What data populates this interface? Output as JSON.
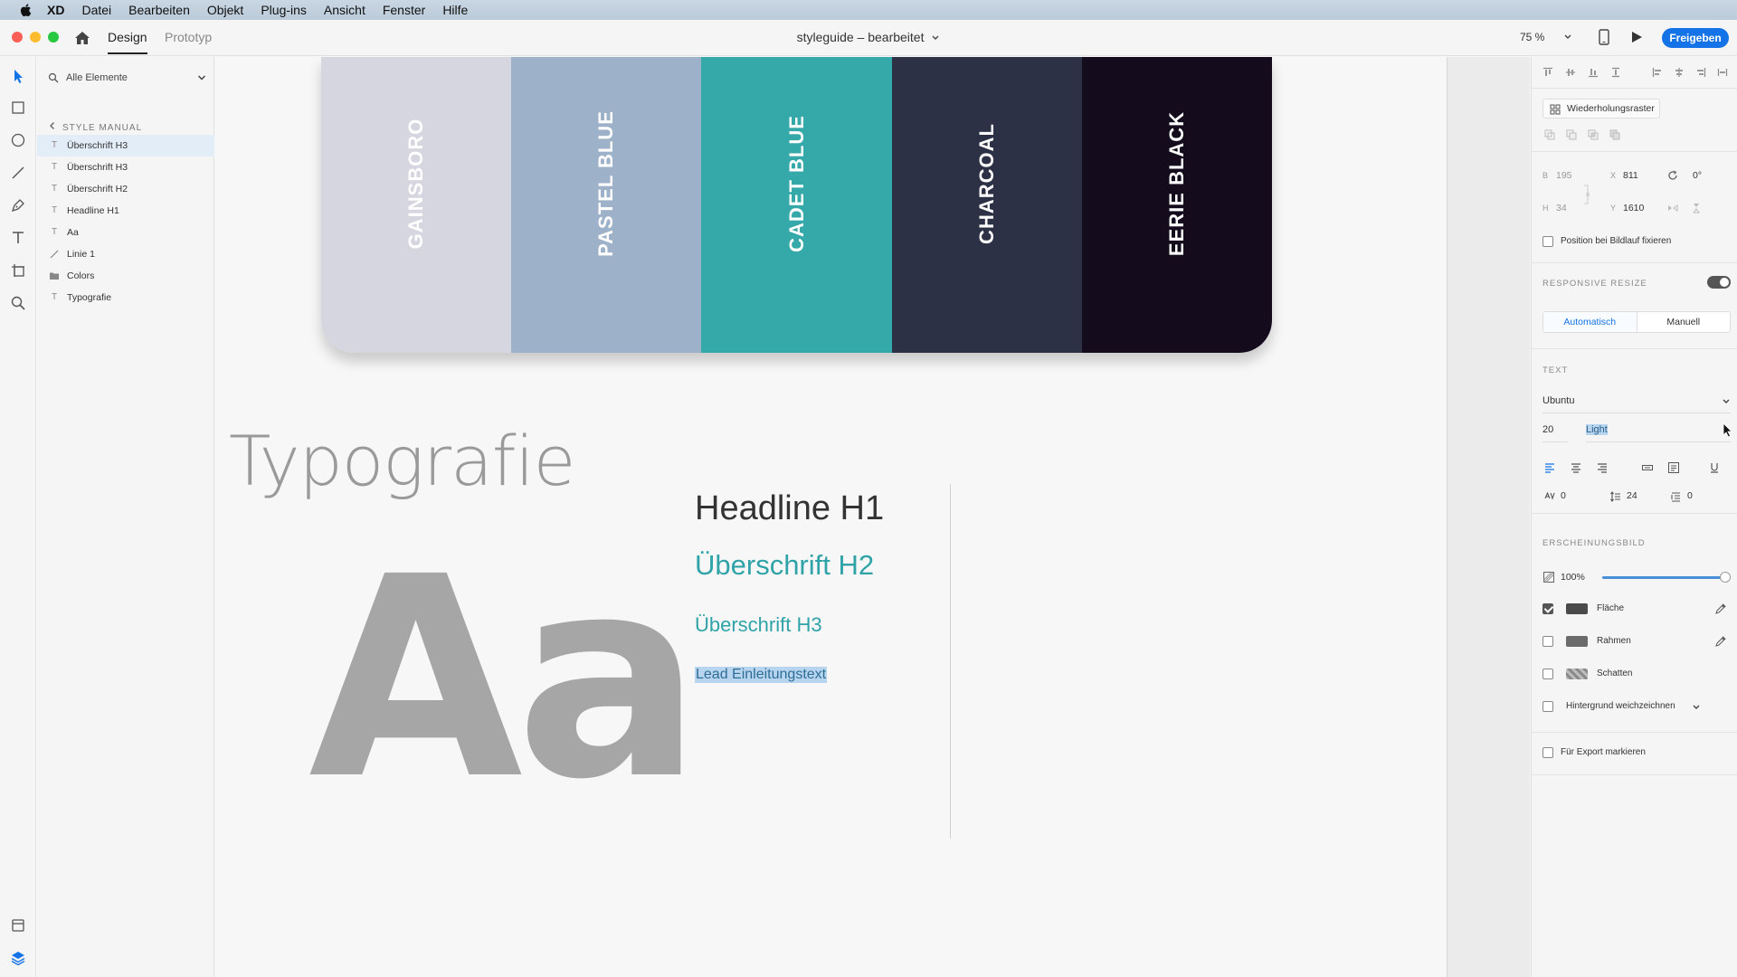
{
  "menubar": {
    "app_name": "XD",
    "items": [
      "Datei",
      "Bearbeiten",
      "Objekt",
      "Plug-ins",
      "Ansicht",
      "Fenster",
      "Hilfe"
    ]
  },
  "titlebar": {
    "tabs": [
      "Design",
      "Prototyp"
    ],
    "document_title": "styleguide – bearbeitet",
    "zoom": "75 %",
    "share_label": "Freigeben"
  },
  "layers": {
    "search_placeholder": "Alle Elemente",
    "breadcrumb": "STYLE MANUAL",
    "items": [
      {
        "label": "Überschrift H3",
        "icon": "T"
      },
      {
        "label": "Überschrift H3",
        "icon": "T"
      },
      {
        "label": "Überschrift H2",
        "icon": "T"
      },
      {
        "label": "Headline H1",
        "icon": "T"
      },
      {
        "label": "Aa",
        "icon": "T"
      },
      {
        "label": "Linie 1",
        "icon": "line"
      },
      {
        "label": "Colors",
        "icon": "folder"
      },
      {
        "label": "Typografie",
        "icon": "T"
      }
    ]
  },
  "canvas": {
    "swatches": [
      {
        "name": "GAINSBORO",
        "color": "#d5d6e0"
      },
      {
        "name": "PASTEL BLUE",
        "color": "#9db2c9"
      },
      {
        "name": "CADET BLUE",
        "color": "#35a8a9"
      },
      {
        "name": "CHARCOAL",
        "color": "#2d3145"
      },
      {
        "name": "EERIE BLACK",
        "color": "#140b1d"
      }
    ],
    "typography_title": "Typografie",
    "sample_glyphs": "Aa",
    "headline_h1": "Headline H1",
    "heading_h2": "Überschrift H2",
    "heading_h3": "Überschrift H3",
    "lead_text": "Lead Einleitungstext"
  },
  "inspector": {
    "repeat_grid_label": "Wiederholungsraster",
    "width_label": "B",
    "width_value": "195",
    "height_label": "H",
    "height_value": "34",
    "x_label": "X",
    "x_value": "811",
    "y_label": "Y",
    "y_value": "1610",
    "rotation_value": "0°",
    "fix_position_label": "Position bei Bildlauf fixieren",
    "responsive_resize_title": "RESPONSIVE RESIZE",
    "responsive_resize_on": true,
    "resize_modes": [
      "Automatisch",
      "Manuell"
    ],
    "text_section_title": "TEXT",
    "font_family": "Ubuntu",
    "font_size": "20",
    "font_weight": "Light",
    "char_spacing": "0",
    "line_spacing": "24",
    "paragraph_spacing": "0",
    "appearance_title": "ERSCHEINUNGSBILD",
    "opacity": "100%",
    "opacity_fraction": 1.0,
    "fill_label": "Fläche",
    "fill_checked": true,
    "fill_color": "#4a4a4a",
    "border_label": "Rahmen",
    "border_checked": false,
    "border_color": "#6b6b6b",
    "shadow_label": "Schatten",
    "shadow_checked": false,
    "bg_blur_label": "Hintergrund weichzeichnen",
    "export_label": "Für Export markieren"
  },
  "colors": {
    "accent": "#1473e6",
    "teal_text": "#2fa3a8"
  }
}
